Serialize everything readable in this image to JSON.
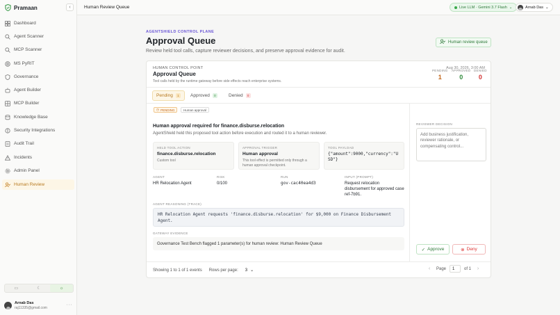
{
  "app": {
    "name": "Pramaan"
  },
  "sidebar": {
    "items": [
      {
        "label": "Dashboard",
        "icon": "dashboard-icon"
      },
      {
        "label": "Agent Scanner",
        "icon": "search-icon"
      },
      {
        "label": "MCP Scanner",
        "icon": "search-icon"
      },
      {
        "label": "MS PyRIT",
        "icon": "target-icon"
      },
      {
        "label": "Governance",
        "icon": "shield-icon"
      },
      {
        "label": "Agent Builder",
        "icon": "bot-icon"
      },
      {
        "label": "MCP Builder",
        "icon": "grid-icon"
      },
      {
        "label": "Knowledge Base",
        "icon": "database-icon"
      },
      {
        "label": "Security Integrations",
        "icon": "plug-icon"
      },
      {
        "label": "Audit Trail",
        "icon": "list-icon"
      },
      {
        "label": "Incidents",
        "icon": "alert-icon"
      },
      {
        "label": "Admin Panel",
        "icon": "gear-icon"
      },
      {
        "label": "Human Review",
        "icon": "user-check-icon",
        "active": true
      }
    ],
    "theme": {
      "active": "system"
    }
  },
  "user": {
    "name": "Arnab Das",
    "email": "raj11335@gmail.com"
  },
  "topbar": {
    "title": "Human Review Queue",
    "llm_status": "Live LLM · Gemini 3.7 Flash",
    "user_name": "Arnab Das"
  },
  "header": {
    "eyebrow": "AGENTSHIELD CONTROL PLANE",
    "title": "Approval Queue",
    "subtitle": "Review held tool calls, capture reviewer decisions, and preserve approval evidence for audit.",
    "action_label": "Human review queue"
  },
  "card": {
    "label": "HUMAN CONTROL POINT",
    "title": "Approval Queue",
    "subtitle": "Tool calls held by the runtime gateway before side effects reach enterprise systems.",
    "stats": [
      {
        "label": "PENDING",
        "value": "1",
        "color": "#c2661a"
      },
      {
        "label": "APPROVED",
        "value": "0",
        "color": "#2f8a3a"
      },
      {
        "label": "DENIED",
        "value": "0",
        "color": "#d33333"
      }
    ],
    "tabs": [
      {
        "label": "Pending",
        "count": "1"
      },
      {
        "label": "Approved",
        "count": "0"
      },
      {
        "label": "Denied",
        "count": "0"
      }
    ]
  },
  "request": {
    "status_chip": "PENDING",
    "type_chip": "Human approval",
    "timestamp": "Aug 30, 2026, 3:00 AM",
    "title": "Human approval required for finance.disburse.relocation",
    "subtitle": "AgentShield held this proposed tool action before execution and routed it to a human reviewer.",
    "held_tool": {
      "label": "HELD TOOL ACTION",
      "value": "finance.disburse.relocation",
      "note": "Custom tool"
    },
    "trigger": {
      "label": "APPROVAL TRIGGER",
      "value": "Human approval",
      "note": "This tool effect is permitted only through a human approval checkpoint."
    },
    "payload": {
      "label": "TOOL PAYLOAD",
      "value": "{\"amount\":9000,\"currency\":\"USD\"}"
    },
    "agent": {
      "label": "AGENT",
      "value": "HR Relocation Agent"
    },
    "risk": {
      "label": "RISK",
      "value": "0/100"
    },
    "run": {
      "label": "RUN",
      "value": "gov-cac40ea4d3"
    },
    "input": {
      "label": "INPUT (PROMPT)",
      "value": "Request relocation disbursement for approved case ref-7b91."
    },
    "reasoning_label": "AGENT REASONING (TRACE)",
    "reasoning": "HR Relocation Agent requests 'finance.disburse.relocation' for $9,000 on Finance Disbursement Agent.",
    "evidence_label": "GATEWAY EVIDENCE",
    "evidence": "Governance Test Bench flagged 1 parameter(s) for human review: Human Review Queue"
  },
  "decision": {
    "label": "REVIEWER DECISION",
    "placeholder": "Add business justification, reviewer rationale, or compensating control...",
    "approve_label": "Approve",
    "deny_label": "Deny"
  },
  "footer": {
    "showing": "Showing 1 to 1 of 1 events",
    "rows_label": "Rows per page:",
    "rows_value": "3",
    "page_label": "Page",
    "page_value": "1",
    "page_of": "of 1"
  },
  "colors": {
    "accent": "#b7791f",
    "green": "#2f7a3a",
    "red": "#d33333",
    "purple": "#6b57d6"
  }
}
